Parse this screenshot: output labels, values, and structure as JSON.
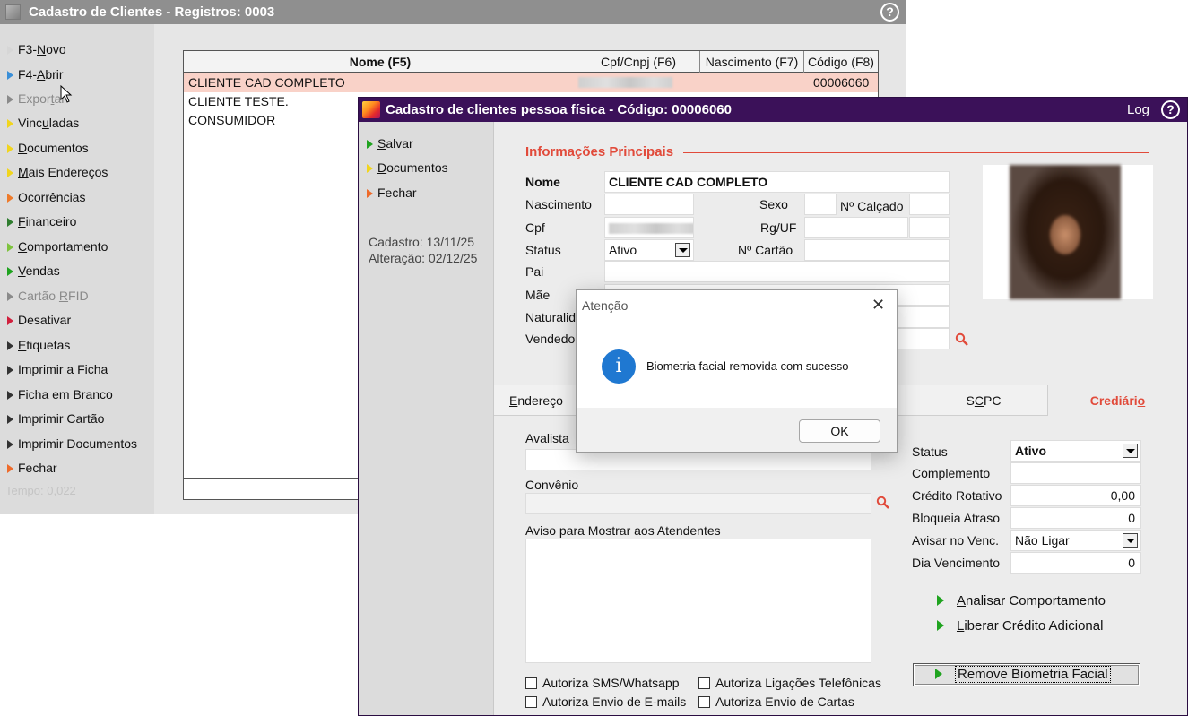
{
  "back_window": {
    "title": "Cadastro de Clientes - Registros: 0003",
    "help_glyph": "?",
    "menu": [
      {
        "pre": "F3-",
        "u": "N",
        "post": "ovo",
        "color": "#d6d6d6",
        "disabled": false
      },
      {
        "pre": "F4-",
        "u": "A",
        "post": "brir",
        "color": "#3a8fd8",
        "disabled": false
      },
      {
        "pre": "Expor",
        "u": "t",
        "post": "ar",
        "color": "#8a8a8a",
        "disabled": true
      },
      {
        "pre": "Vinc",
        "u": "u",
        "post": "ladas",
        "color": "#f1d51e",
        "disabled": false
      },
      {
        "pre": "",
        "u": "D",
        "post": "ocumentos",
        "color": "#f1d51e",
        "disabled": false
      },
      {
        "pre": "",
        "u": "M",
        "post": "ais Endereços",
        "color": "#f1d51e",
        "disabled": false
      },
      {
        "pre": "",
        "u": "O",
        "post": "corrências",
        "color": "#ee7b2b",
        "disabled": false
      },
      {
        "pre": "",
        "u": "F",
        "post": "inanceiro",
        "color": "#2f7d2f",
        "disabled": false
      },
      {
        "pre": "",
        "u": "C",
        "post": "omportamento",
        "color": "#7ec33e",
        "disabled": false
      },
      {
        "pre": "",
        "u": "V",
        "post": "endas",
        "color": "#1fa31f",
        "disabled": false
      },
      {
        "pre": "Cartão ",
        "u": "R",
        "post": "FID",
        "color": "#8a8a8a",
        "disabled": true
      },
      {
        "pre": "Desativar",
        "u": "",
        "post": "",
        "color": "#d1203d",
        "disabled": false
      },
      {
        "pre": "",
        "u": "E",
        "post": "tiquetas",
        "color": "#333333",
        "disabled": false
      },
      {
        "pre": "",
        "u": "I",
        "post": "mprimir a Ficha",
        "color": "#333333",
        "disabled": false
      },
      {
        "pre": "Ficha em Branco",
        "u": "",
        "post": "",
        "color": "#333333",
        "disabled": false
      },
      {
        "pre": "Imprimir Cartão",
        "u": "",
        "post": "",
        "color": "#333333",
        "disabled": false
      },
      {
        "pre": "Imprimir Documentos",
        "u": "",
        "post": "",
        "color": "#333333",
        "disabled": false
      },
      {
        "pre": "Fechar",
        "u": "",
        "post": "",
        "color": "#ee6b2b",
        "disabled": false
      }
    ],
    "tempo": "Tempo:  0,022",
    "grid": {
      "headers": [
        "Nome (F5)",
        "Cpf/Cnpj (F6)",
        "Nascimento (F7)",
        "Código (F8)"
      ],
      "rows": [
        {
          "nome": "CLIENTE CAD COMPLETO",
          "codigo": "00006060",
          "selected": true
        },
        {
          "nome": "CLIENTE TESTE.",
          "codigo": "",
          "selected": false
        },
        {
          "nome": "CONSUMIDOR",
          "codigo": "",
          "selected": false
        }
      ]
    }
  },
  "front_window": {
    "title": "Cadastro de clientes pessoa física - Código: 00006060",
    "log": "Log",
    "help_glyph": "?",
    "sidebar": {
      "salvar": {
        "u": "S",
        "post": "alvar"
      },
      "documentos": {
        "u": "D",
        "post": "ocumentos"
      },
      "fechar": "Fechar",
      "cadastro": "Cadastro: 13/11/25",
      "alteracao": "Alteração: 02/12/25"
    },
    "section_title": "Informações Principais",
    "labels": {
      "nome": "Nome",
      "nascimento": "Nascimento",
      "cpf": "Cpf",
      "status": "Status",
      "pai": "Pai",
      "mae": "Mãe",
      "naturalidade": "Naturalid",
      "vendedor": "Vendedo",
      "sexo": "Sexo",
      "calcado": "Nº Calçado",
      "rg": "Rg/UF",
      "cartao": "Nº Cartão"
    },
    "values": {
      "nome": "CLIENTE CAD COMPLETO",
      "status": "Ativo"
    },
    "tabs": [
      {
        "label_u": "E",
        "label_post": "ndereço",
        "active": false
      },
      {
        "label_pre": "S",
        "label_u": "C",
        "label_post": "PC",
        "active": false
      },
      {
        "label_pre": "Crediári",
        "label_u": "o",
        "label_post": "",
        "active": true
      }
    ],
    "crediario": {
      "avalista": "Avalista",
      "convenio": "Convênio",
      "aviso": "Aviso para Mostrar aos Atendentes",
      "status_label": "Status",
      "status_value": "Ativo",
      "complemento_label": "Complemento",
      "credito_label": "Crédito Rotativo",
      "credito_value": "0,00",
      "bloqueia_label": "Bloqueia Atraso",
      "bloqueia_value": "0",
      "avisar_label": "Avisar no Venc.",
      "avisar_value": "Não Ligar",
      "dia_label": "Dia Vencimento",
      "dia_value": "0",
      "analisar": {
        "u": "A",
        "post": "nalisar Comportamento"
      },
      "liberar": {
        "u": "L",
        "post": "iberar Crédito Adicional"
      },
      "remove_biometria": "Remove Biometria Facial",
      "checks": [
        "Autoriza SMS/Whatsapp",
        "Autoriza Ligações Telefônicas",
        "Autoriza Envio de E-mails",
        "Autoriza Envio de Cartas"
      ]
    },
    "accent": "#e14a3a"
  },
  "dialog": {
    "title": "Atenção",
    "close_glyph": "✕",
    "icon_glyph": "i",
    "message": "Biometria facial removida com sucesso",
    "ok": "OK"
  }
}
